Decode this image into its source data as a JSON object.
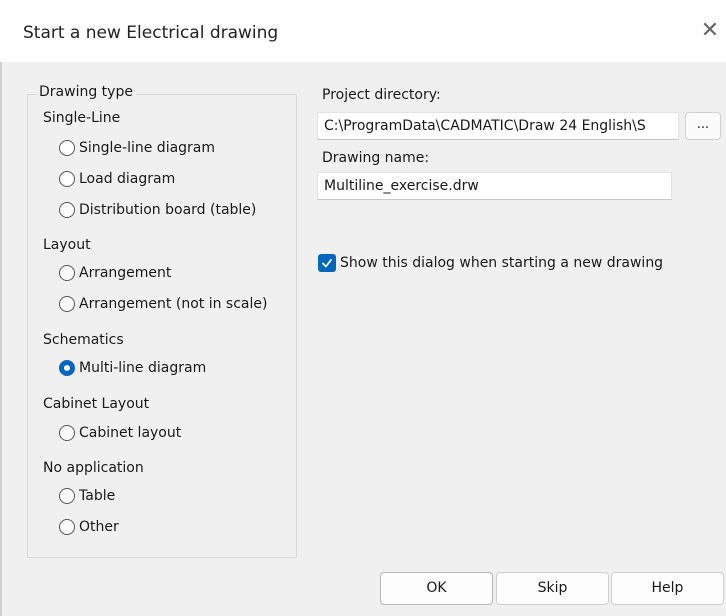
{
  "window": {
    "title": "Start a new Electrical drawing"
  },
  "drawing_type": {
    "legend": "Drawing type",
    "sections": [
      {
        "label": "Single-Line",
        "options": [
          {
            "label": "Single-line diagram",
            "checked": false
          },
          {
            "label": "Load diagram",
            "checked": false
          },
          {
            "label": "Distribution board (table)",
            "checked": false
          }
        ]
      },
      {
        "label": "Layout",
        "options": [
          {
            "label": "Arrangement",
            "checked": false
          },
          {
            "label": "Arrangement (not in scale)",
            "checked": false
          }
        ]
      },
      {
        "label": "Schematics",
        "options": [
          {
            "label": "Multi-line diagram",
            "checked": true
          }
        ]
      },
      {
        "label": "Cabinet Layout",
        "options": [
          {
            "label": "Cabinet layout",
            "checked": false
          }
        ]
      },
      {
        "label": "No application",
        "options": [
          {
            "label": "Table",
            "checked": false
          },
          {
            "label": "Other",
            "checked": false
          }
        ]
      }
    ]
  },
  "project_directory": {
    "label": "Project directory:",
    "value": "C:\\ProgramData\\CADMATIC\\Draw 24 English\\S",
    "browse_label": "..."
  },
  "drawing_name": {
    "label": "Drawing name:",
    "value": "Multiline_exercise.drw"
  },
  "show_dialog": {
    "label": "Show this dialog when starting a new drawing",
    "checked": true
  },
  "buttons": {
    "ok": "OK",
    "skip": "Skip",
    "help": "Help"
  },
  "colors": {
    "accent": "#0067c0",
    "background": "#f0f0f0"
  },
  "icons": {
    "close": "close-icon",
    "check": "checkmark-icon"
  }
}
